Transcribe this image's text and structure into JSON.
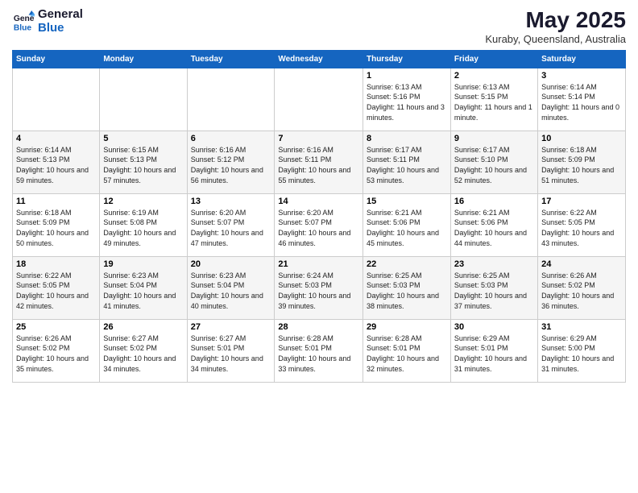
{
  "logo": {
    "line1": "General",
    "line2": "Blue"
  },
  "title": "May 2025",
  "subtitle": "Kuraby, Queensland, Australia",
  "days_of_week": [
    "Sunday",
    "Monday",
    "Tuesday",
    "Wednesday",
    "Thursday",
    "Friday",
    "Saturday"
  ],
  "weeks": [
    [
      {
        "day": "",
        "sunrise": "",
        "sunset": "",
        "daylight": ""
      },
      {
        "day": "",
        "sunrise": "",
        "sunset": "",
        "daylight": ""
      },
      {
        "day": "",
        "sunrise": "",
        "sunset": "",
        "daylight": ""
      },
      {
        "day": "",
        "sunrise": "",
        "sunset": "",
        "daylight": ""
      },
      {
        "day": "1",
        "sunrise": "Sunrise: 6:13 AM",
        "sunset": "Sunset: 5:16 PM",
        "daylight": "Daylight: 11 hours and 3 minutes."
      },
      {
        "day": "2",
        "sunrise": "Sunrise: 6:13 AM",
        "sunset": "Sunset: 5:15 PM",
        "daylight": "Daylight: 11 hours and 1 minute."
      },
      {
        "day": "3",
        "sunrise": "Sunrise: 6:14 AM",
        "sunset": "Sunset: 5:14 PM",
        "daylight": "Daylight: 11 hours and 0 minutes."
      }
    ],
    [
      {
        "day": "4",
        "sunrise": "Sunrise: 6:14 AM",
        "sunset": "Sunset: 5:13 PM",
        "daylight": "Daylight: 10 hours and 59 minutes."
      },
      {
        "day": "5",
        "sunrise": "Sunrise: 6:15 AM",
        "sunset": "Sunset: 5:13 PM",
        "daylight": "Daylight: 10 hours and 57 minutes."
      },
      {
        "day": "6",
        "sunrise": "Sunrise: 6:16 AM",
        "sunset": "Sunset: 5:12 PM",
        "daylight": "Daylight: 10 hours and 56 minutes."
      },
      {
        "day": "7",
        "sunrise": "Sunrise: 6:16 AM",
        "sunset": "Sunset: 5:11 PM",
        "daylight": "Daylight: 10 hours and 55 minutes."
      },
      {
        "day": "8",
        "sunrise": "Sunrise: 6:17 AM",
        "sunset": "Sunset: 5:11 PM",
        "daylight": "Daylight: 10 hours and 53 minutes."
      },
      {
        "day": "9",
        "sunrise": "Sunrise: 6:17 AM",
        "sunset": "Sunset: 5:10 PM",
        "daylight": "Daylight: 10 hours and 52 minutes."
      },
      {
        "day": "10",
        "sunrise": "Sunrise: 6:18 AM",
        "sunset": "Sunset: 5:09 PM",
        "daylight": "Daylight: 10 hours and 51 minutes."
      }
    ],
    [
      {
        "day": "11",
        "sunrise": "Sunrise: 6:18 AM",
        "sunset": "Sunset: 5:09 PM",
        "daylight": "Daylight: 10 hours and 50 minutes."
      },
      {
        "day": "12",
        "sunrise": "Sunrise: 6:19 AM",
        "sunset": "Sunset: 5:08 PM",
        "daylight": "Daylight: 10 hours and 49 minutes."
      },
      {
        "day": "13",
        "sunrise": "Sunrise: 6:20 AM",
        "sunset": "Sunset: 5:07 PM",
        "daylight": "Daylight: 10 hours and 47 minutes."
      },
      {
        "day": "14",
        "sunrise": "Sunrise: 6:20 AM",
        "sunset": "Sunset: 5:07 PM",
        "daylight": "Daylight: 10 hours and 46 minutes."
      },
      {
        "day": "15",
        "sunrise": "Sunrise: 6:21 AM",
        "sunset": "Sunset: 5:06 PM",
        "daylight": "Daylight: 10 hours and 45 minutes."
      },
      {
        "day": "16",
        "sunrise": "Sunrise: 6:21 AM",
        "sunset": "Sunset: 5:06 PM",
        "daylight": "Daylight: 10 hours and 44 minutes."
      },
      {
        "day": "17",
        "sunrise": "Sunrise: 6:22 AM",
        "sunset": "Sunset: 5:05 PM",
        "daylight": "Daylight: 10 hours and 43 minutes."
      }
    ],
    [
      {
        "day": "18",
        "sunrise": "Sunrise: 6:22 AM",
        "sunset": "Sunset: 5:05 PM",
        "daylight": "Daylight: 10 hours and 42 minutes."
      },
      {
        "day": "19",
        "sunrise": "Sunrise: 6:23 AM",
        "sunset": "Sunset: 5:04 PM",
        "daylight": "Daylight: 10 hours and 41 minutes."
      },
      {
        "day": "20",
        "sunrise": "Sunrise: 6:23 AM",
        "sunset": "Sunset: 5:04 PM",
        "daylight": "Daylight: 10 hours and 40 minutes."
      },
      {
        "day": "21",
        "sunrise": "Sunrise: 6:24 AM",
        "sunset": "Sunset: 5:03 PM",
        "daylight": "Daylight: 10 hours and 39 minutes."
      },
      {
        "day": "22",
        "sunrise": "Sunrise: 6:25 AM",
        "sunset": "Sunset: 5:03 PM",
        "daylight": "Daylight: 10 hours and 38 minutes."
      },
      {
        "day": "23",
        "sunrise": "Sunrise: 6:25 AM",
        "sunset": "Sunset: 5:03 PM",
        "daylight": "Daylight: 10 hours and 37 minutes."
      },
      {
        "day": "24",
        "sunrise": "Sunrise: 6:26 AM",
        "sunset": "Sunset: 5:02 PM",
        "daylight": "Daylight: 10 hours and 36 minutes."
      }
    ],
    [
      {
        "day": "25",
        "sunrise": "Sunrise: 6:26 AM",
        "sunset": "Sunset: 5:02 PM",
        "daylight": "Daylight: 10 hours and 35 minutes."
      },
      {
        "day": "26",
        "sunrise": "Sunrise: 6:27 AM",
        "sunset": "Sunset: 5:02 PM",
        "daylight": "Daylight: 10 hours and 34 minutes."
      },
      {
        "day": "27",
        "sunrise": "Sunrise: 6:27 AM",
        "sunset": "Sunset: 5:01 PM",
        "daylight": "Daylight: 10 hours and 34 minutes."
      },
      {
        "day": "28",
        "sunrise": "Sunrise: 6:28 AM",
        "sunset": "Sunset: 5:01 PM",
        "daylight": "Daylight: 10 hours and 33 minutes."
      },
      {
        "day": "29",
        "sunrise": "Sunrise: 6:28 AM",
        "sunset": "Sunset: 5:01 PM",
        "daylight": "Daylight: 10 hours and 32 minutes."
      },
      {
        "day": "30",
        "sunrise": "Sunrise: 6:29 AM",
        "sunset": "Sunset: 5:01 PM",
        "daylight": "Daylight: 10 hours and 31 minutes."
      },
      {
        "day": "31",
        "sunrise": "Sunrise: 6:29 AM",
        "sunset": "Sunset: 5:00 PM",
        "daylight": "Daylight: 10 hours and 31 minutes."
      }
    ]
  ]
}
